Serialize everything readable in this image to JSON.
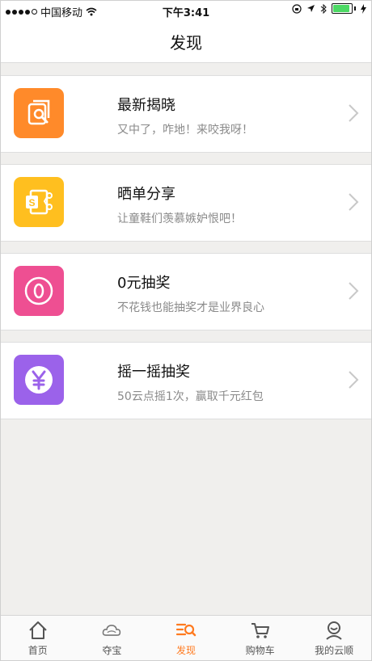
{
  "status_bar": {
    "carrier": "中国移动",
    "time": "下午3:41"
  },
  "nav": {
    "title": "发现"
  },
  "items": [
    {
      "title": "最新揭晓",
      "subtitle": "又中了，咋地！来咬我呀！",
      "icon": "search-document-icon",
      "color": "#ff8a2a"
    },
    {
      "title": "晒单分享",
      "subtitle": "让童鞋们羡慕嫉妒恨吧！",
      "icon": "share-doc-icon",
      "color": "#ffbf1f"
    },
    {
      "title": "0元抽奖",
      "subtitle": "不花钱也能抽奖才是业界良心",
      "icon": "zero-coin-icon",
      "color": "#ee4f92"
    },
    {
      "title": "摇一摇抽奖",
      "subtitle": "50云点摇1次，赢取千元红包",
      "icon": "yen-coin-icon",
      "color": "#9b62ea"
    }
  ],
  "tabs": [
    {
      "label": "首页",
      "icon": "home-icon",
      "active": false
    },
    {
      "label": "夺宝",
      "icon": "cloud-icon",
      "active": false
    },
    {
      "label": "发现",
      "icon": "discover-icon",
      "active": true
    },
    {
      "label": "购物车",
      "icon": "cart-icon",
      "active": false
    },
    {
      "label": "我的云顺",
      "icon": "profile-icon",
      "active": false
    }
  ],
  "colors": {
    "accent": "#ff7a1f"
  }
}
